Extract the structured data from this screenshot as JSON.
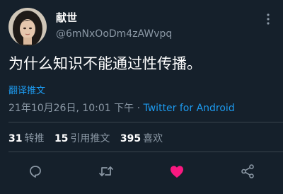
{
  "author": {
    "display_name": "献世",
    "handle": "@6mNxOoDm4zAWvpq"
  },
  "tweet": {
    "text": "为什么知识不能通过性传播。",
    "translate_label": "翻译推文",
    "timestamp": "21年10月26日, 10:01 下午",
    "separator": " · ",
    "source": "Twitter for Android"
  },
  "stats": [
    {
      "count": "31",
      "label": "转推"
    },
    {
      "count": "15",
      "label": "引用推文"
    },
    {
      "count": "395",
      "label": "喜欢"
    }
  ],
  "actions": {
    "reply_icon": "reply-icon",
    "retweet_icon": "retweet-icon",
    "like_icon": "heart-icon",
    "share_icon": "share-icon"
  },
  "colors": {
    "background": "#15202b",
    "link": "#1d9bf0",
    "secondary_text": "#8b98a5",
    "like_active": "#f91880",
    "divider": "#38444d"
  }
}
